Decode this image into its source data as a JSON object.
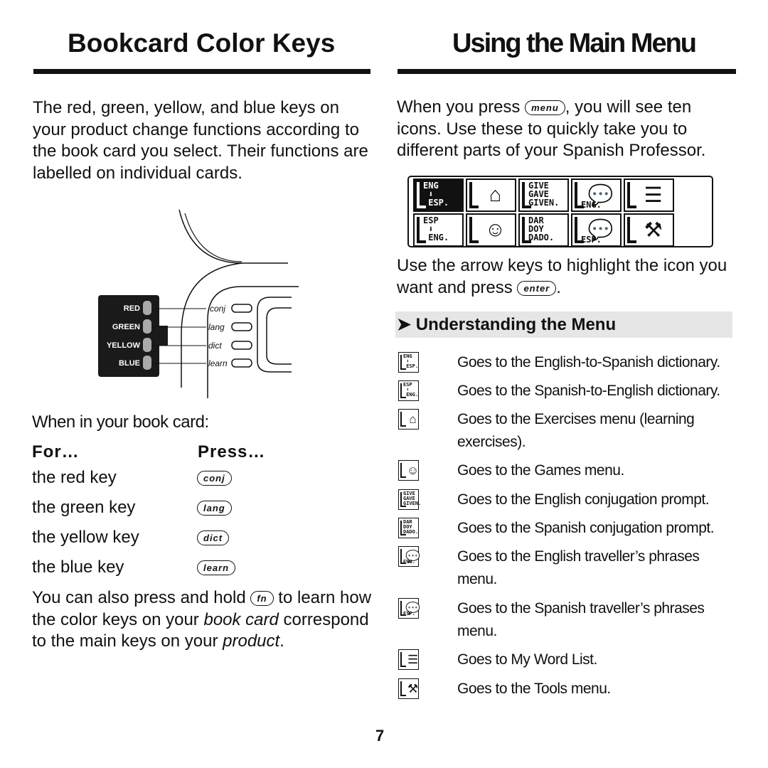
{
  "left": {
    "title": "Bookcard Color Keys",
    "intro": "The red, green, yellow, and blue keys on your product change functions according to the book card you select. Their functions are labelled on individual cards.",
    "diagram": {
      "keys": [
        "RED",
        "GREEN",
        "YELLOW",
        "BLUE"
      ],
      "targets": [
        "conj",
        "lang",
        "dict",
        "learn"
      ]
    },
    "when": "When in your book card:",
    "col_for": "For…",
    "col_press": "Press…",
    "rows": [
      {
        "for": "the red key",
        "press": "conj"
      },
      {
        "for": "the green key",
        "press": "lang"
      },
      {
        "for": "the yellow key",
        "press": "dict"
      },
      {
        "for": "the blue key",
        "press": "learn"
      }
    ],
    "also_a": "You can also press and hold",
    "fn_key": "fn",
    "also_b": "to learn how the color keys on your",
    "also_c": "book card",
    "also_d": "correspond to the main keys on your",
    "also_e": "product",
    "also_f": "."
  },
  "right": {
    "title": "Using the Main Menu",
    "p1a": "When you press",
    "menu_key": "menu",
    "p1b": ", you will see ten icons. Use these to quickly take you to different parts of your Spanish Professor.",
    "p2a": "Use the arrow keys to highlight the icon you want and press",
    "enter_key": "enter",
    "p2b": ".",
    "section": "Understanding the Menu",
    "icons": [
      {
        "icon": "eng-to-esp-icon",
        "text": "ENG\n ⬇\n ESP.",
        "desc": "Goes to the English-to-Spanish dictionary."
      },
      {
        "icon": "esp-to-eng-icon",
        "text": "ESP\n ⬇\n ENG.",
        "desc": "Goes to the Spanish-to-English dictionary."
      },
      {
        "icon": "exercises-schoolhouse-icon",
        "glyph": "⌂",
        "desc": "Goes to the Exercises menu (learning exercises)."
      },
      {
        "icon": "games-smiley-icon",
        "glyph": "☺",
        "desc": "Goes to the Games menu."
      },
      {
        "icon": "english-conjugation-icon",
        "text": "GIVE\nGAVE\nGIVEN.",
        "desc": "Goes to the English conjugation prompt."
      },
      {
        "icon": "spanish-conjugation-icon",
        "text": "DAR\nDOY\nDADO.",
        "desc": "Goes to the Spanish conjugation prompt."
      },
      {
        "icon": "english-phrases-icon",
        "glyph": "💬",
        "sub": "ENG.",
        "desc": "Goes to the English traveller’s phrases menu."
      },
      {
        "icon": "spanish-phrases-icon",
        "glyph": "💬",
        "sub": "ESP.",
        "desc": "Goes to the Spanish traveller’s phrases menu."
      },
      {
        "icon": "word-list-icon",
        "glyph": "☰",
        "desc": "Goes to My Word List."
      },
      {
        "icon": "tools-icon",
        "glyph": "⚒",
        "desc": "Goes to the Tools menu."
      }
    ]
  },
  "page_number": "7"
}
